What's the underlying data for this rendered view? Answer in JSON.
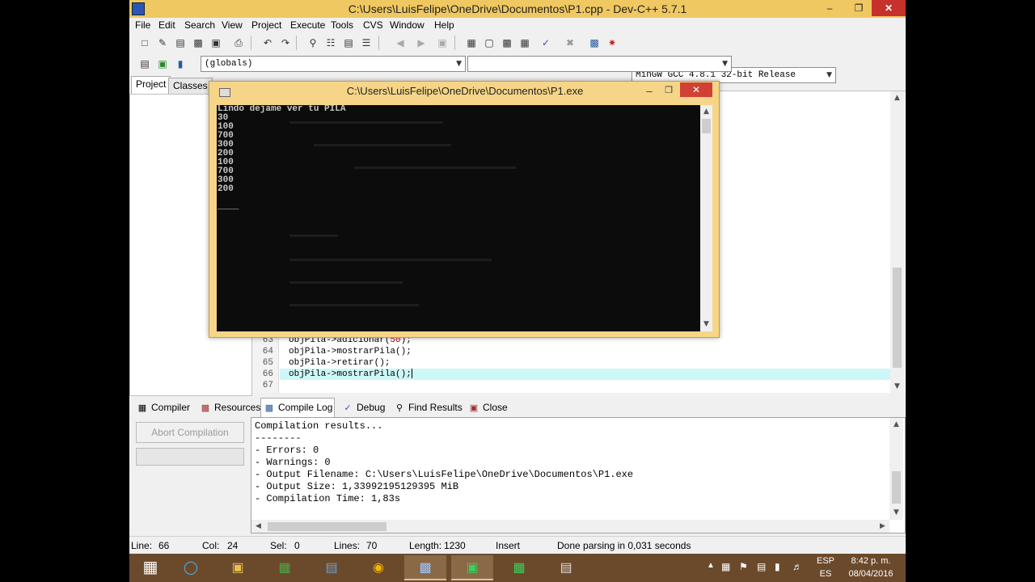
{
  "window": {
    "title": "C:\\Users\\LuisFelipe\\OneDrive\\Documentos\\P1.cpp - Dev-C++ 5.7.1",
    "min_glyph": "–",
    "max_glyph": "❐",
    "close_glyph": "✕"
  },
  "menu": [
    "File",
    "Edit",
    "Search",
    "View",
    "Project",
    "Execute",
    "Tools",
    "CVS",
    "Window",
    "Help"
  ],
  "toolbar": {
    "compiler_select": "MinGW GCC 4.8.1 32-bit Release",
    "scope_select": "(globals)",
    "member_select": ""
  },
  "project_tabs": [
    "Project",
    "Classes"
  ],
  "editor": {
    "lines": [
      {
        "num": "63",
        "code": "objPila->adicionar(50);"
      },
      {
        "num": "64",
        "code": "objPila->mostrarPila();"
      },
      {
        "num": "65",
        "code": "objPila->retirar();"
      },
      {
        "num": "66",
        "code": "objPila->mostrarPila();"
      },
      {
        "num": "67",
        "code": ""
      }
    ]
  },
  "console": {
    "title": "C:\\Users\\LuisFelipe\\OneDrive\\Documentos\\P1.exe",
    "output": "Lindo dejame ver tu PILA\n30\n100\n700\n300\n200\n100\n700\n300\n200\n\n____",
    "min_glyph": "–",
    "max_glyph": "❐",
    "close_glyph": "✕"
  },
  "bottom_tabs": [
    {
      "label": "Compiler",
      "icon": "grid-icon"
    },
    {
      "label": "Resources",
      "icon": "resources-icon"
    },
    {
      "label": "Compile Log",
      "icon": "chart-icon"
    },
    {
      "label": "Debug",
      "icon": "check-icon"
    },
    {
      "label": "Find Results",
      "icon": "find-icon"
    },
    {
      "label": "Close",
      "icon": "close-icon"
    }
  ],
  "compile": {
    "abort_label": "Abort Compilation",
    "log": [
      "Compilation results...",
      "--------",
      "- Errors: 0",
      "- Warnings: 0",
      "- Output Filename: C:\\Users\\LuisFelipe\\OneDrive\\Documentos\\P1.exe",
      "- Output Size: 1,33992195129395 MiB",
      "- Compilation Time: 1,83s"
    ]
  },
  "status": {
    "line_label": "Line:",
    "line_value": "66",
    "col_label": "Col:",
    "col_value": "24",
    "sel_label": "Sel:",
    "sel_value": "0",
    "lines_label": "Lines:",
    "lines_value": "70",
    "length_label": "Length:",
    "length_value": "1230",
    "mode": "Insert",
    "message": "Done parsing in 0,031 seconds"
  },
  "taskbar": {
    "lang_1": "ESP",
    "lang_2": "ES",
    "time": "8:42 p. m.",
    "date": "08/04/2016"
  },
  "colors": {
    "title_bar": "#f0c862",
    "console_frame": "#f6d588",
    "close_button": "#c7312b",
    "taskbar": "#6b4a2c",
    "current_line": "#cdf7f7"
  }
}
